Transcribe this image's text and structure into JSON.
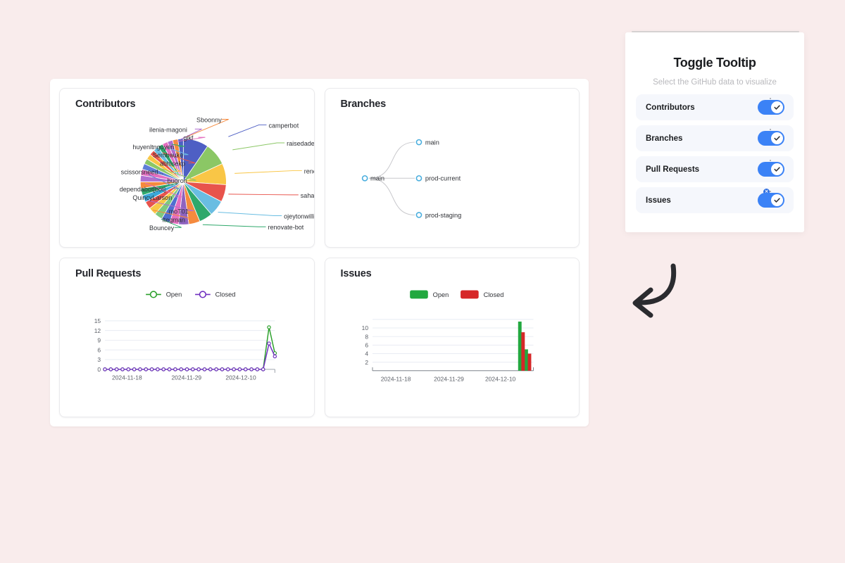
{
  "page": {
    "background_color": "#f9ecec"
  },
  "panel": {
    "title": "Toggle Tooltip",
    "subtitle": "Select the GitHub data to visualize",
    "accent_color": "#3b82f6",
    "row_background": "#f5f7fc",
    "badge_glyph": "×",
    "toggles": [
      {
        "label": "Contributors",
        "state": "on",
        "has_badge": false
      },
      {
        "label": "Branches",
        "state": "on",
        "has_badge": false
      },
      {
        "label": "Pull Requests",
        "state": "on",
        "has_badge": false
      },
      {
        "label": "Issues",
        "state": "on",
        "has_badge": true
      }
    ]
  },
  "cards": {
    "contributors": {
      "title": "Contributors"
    },
    "branches": {
      "title": "Branches"
    },
    "pull_requests": {
      "title": "Pull Requests"
    },
    "issues": {
      "title": "Issues"
    }
  },
  "chart_data": [
    {
      "id": "contributors",
      "type": "pie",
      "title": "Contributors",
      "legend": "labelled-callouts",
      "labels": [
        "camperbot",
        "raisedadead",
        "renovate[bot]",
        "sahat",
        "ojeytonwilliams",
        "renovate-bot",
        "Bouncey",
        "ltegman",
        "moT01",
        "QuincyLarson",
        "dependabot[bot]",
        "bugron",
        "scissorsneed...",
        "abhisekp",
        "Sembauke",
        "huyenltnguyen",
        "gikf",
        "ilenia-magoni",
        "Sboonny"
      ],
      "values": [
        9.5,
        8.5,
        8.0,
        6.5,
        6.0,
        5.0,
        4.2,
        3.8,
        3.4,
        3.2,
        3.0,
        2.9,
        2.8,
        2.7,
        2.6,
        2.5,
        2.4,
        2.3,
        2.2
      ],
      "colors": [
        "#4e5fc4",
        "#8bc765",
        "#f9c646",
        "#e8544c",
        "#69bde2",
        "#2fa86b",
        "#f58a3e",
        "#8e63c0",
        "#e46fc0",
        "#4d6fd0",
        "#7fc97f",
        "#f7c948",
        "#e8544c",
        "#3aa8d8",
        "#2fa86b",
        "#f58a3e",
        "#b06fd0",
        "#e46fc0",
        "#5f7fd8"
      ],
      "extra_colors": [
        "#8bc765",
        "#f9c646",
        "#e8544c",
        "#69bde2",
        "#2fa86b",
        "#e46fc0",
        "#b06fd0",
        "#f58a3e"
      ]
    },
    {
      "id": "branches",
      "type": "tree",
      "title": "Branches",
      "root": "main",
      "children": [
        "main",
        "prod-current",
        "prod-staging"
      ],
      "node_color": "#4aaede",
      "link_color": "#c8c8cc"
    },
    {
      "id": "pull_requests",
      "type": "line",
      "title": "Pull Requests",
      "legend": [
        "Open",
        "Closed"
      ],
      "legend_colors": [
        "#2ca02c",
        "#7030c0"
      ],
      "xlabel": "",
      "ylabel": "",
      "yticks": [
        0,
        3,
        6,
        9,
        12,
        15
      ],
      "ylim": [
        0,
        15
      ],
      "xticks": [
        "2024-11-18",
        "2024-11-29",
        "2024-12-10"
      ],
      "xtick_positions": [
        0.04,
        0.39,
        0.71
      ],
      "series": [
        {
          "name": "Open",
          "color": "#2ca02c",
          "values": [
            0,
            0,
            0,
            0,
            0,
            0,
            0,
            0,
            0,
            0,
            0,
            0,
            0,
            0,
            0,
            0,
            0,
            0,
            0,
            0,
            0,
            0,
            0,
            0,
            0,
            0,
            0,
            0,
            13,
            5
          ]
        },
        {
          "name": "Closed",
          "color": "#7030c0",
          "values": [
            0,
            0,
            0,
            0,
            0,
            0,
            0,
            0,
            0,
            0,
            0,
            0,
            0,
            0,
            0,
            0,
            0,
            0,
            0,
            0,
            0,
            0,
            0,
            0,
            0,
            0,
            0,
            0,
            8,
            4
          ]
        }
      ]
    },
    {
      "id": "issues",
      "type": "bar",
      "title": "Issues",
      "legend": [
        "Open",
        "Closed"
      ],
      "legend_colors": [
        "#22a83f",
        "#d62728"
      ],
      "xlabel": "",
      "ylabel": "",
      "yticks": [
        2,
        4,
        6,
        8,
        10
      ],
      "ylim": [
        0,
        12
      ],
      "xticks": [
        "2024-11-18",
        "2024-11-29",
        "2024-12-10"
      ],
      "xtick_positions": [
        0.05,
        0.38,
        0.7
      ],
      "series": [
        {
          "name": "Open",
          "color": "#22a83f",
          "bars": [
            {
              "x": 0.905,
              "value": 11.5
            },
            {
              "x": 0.945,
              "value": 5.0
            }
          ]
        },
        {
          "name": "Closed",
          "color": "#d62728",
          "bars": [
            {
              "x": 0.925,
              "value": 9.0
            },
            {
              "x": 0.965,
              "value": 4.0
            }
          ]
        }
      ]
    }
  ],
  "arrow": {
    "name": "curved-arrow",
    "color": "#2b2b2f",
    "direction": "down-left"
  }
}
